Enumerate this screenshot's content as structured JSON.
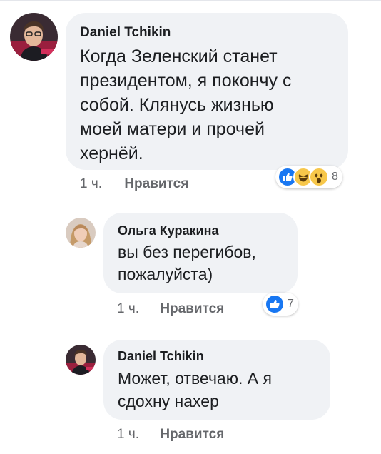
{
  "comments": [
    {
      "author": "Daniel Tchikin",
      "text": "Когда Зеленский станет\nпрезидентом, я покончу с\nсобой. Клянусь жизнью\nмоей матери и прочей\nхернёй.",
      "time": "1 ч.",
      "like_label": "Нравится",
      "reaction_icons": [
        "like-icon",
        "haha-icon",
        "wow-icon"
      ],
      "reaction_count": "8"
    },
    {
      "author": "Ольга Куракина",
      "text": "вы без перегибов,\nпожалуйста)",
      "time": "1 ч.",
      "like_label": "Нравится",
      "reaction_icons": [
        "like-icon"
      ],
      "reaction_count": "7"
    },
    {
      "author": "Daniel Tchikin",
      "text": "Может, отвечаю. А я\nсдохну нахер",
      "time": "1 ч.",
      "like_label": "Нравится"
    }
  ],
  "colors": {
    "bubble": "#f0f2f5",
    "meta": "#65676b",
    "like_blue": "#1877f2",
    "haha_yellow": "#f7c74a"
  }
}
